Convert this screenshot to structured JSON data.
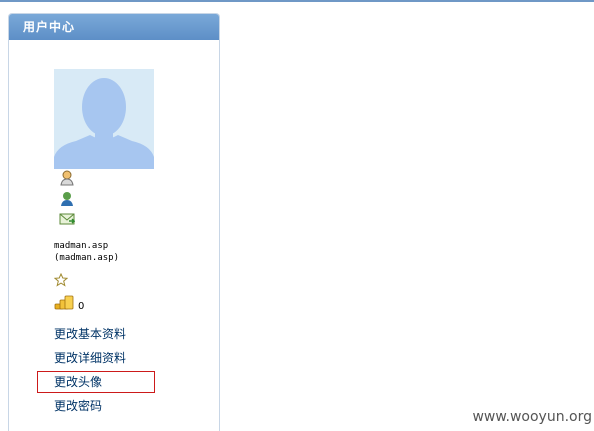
{
  "panel": {
    "title": "用户中心"
  },
  "user": {
    "username_line1": "madman.asp",
    "username_line2": "(madman.asp)",
    "coin_count": "0"
  },
  "menu": {
    "items": [
      {
        "label": "更改基本资料"
      },
      {
        "label": "更改详细资料"
      },
      {
        "label": "更改头像"
      },
      {
        "label": "更改密码"
      }
    ]
  },
  "watermark": "www.wooyun.org",
  "colors": {
    "header_blue": "#5d8fc7",
    "link_color": "#003366",
    "highlight_red": "#cc1a1a",
    "avatar_bg": "#d8eaf6",
    "silhouette": "#a7c6f0"
  },
  "icons": [
    "user-profile-icon",
    "user-online-icon",
    "message-icon",
    "star-icon",
    "coins-icon"
  ]
}
